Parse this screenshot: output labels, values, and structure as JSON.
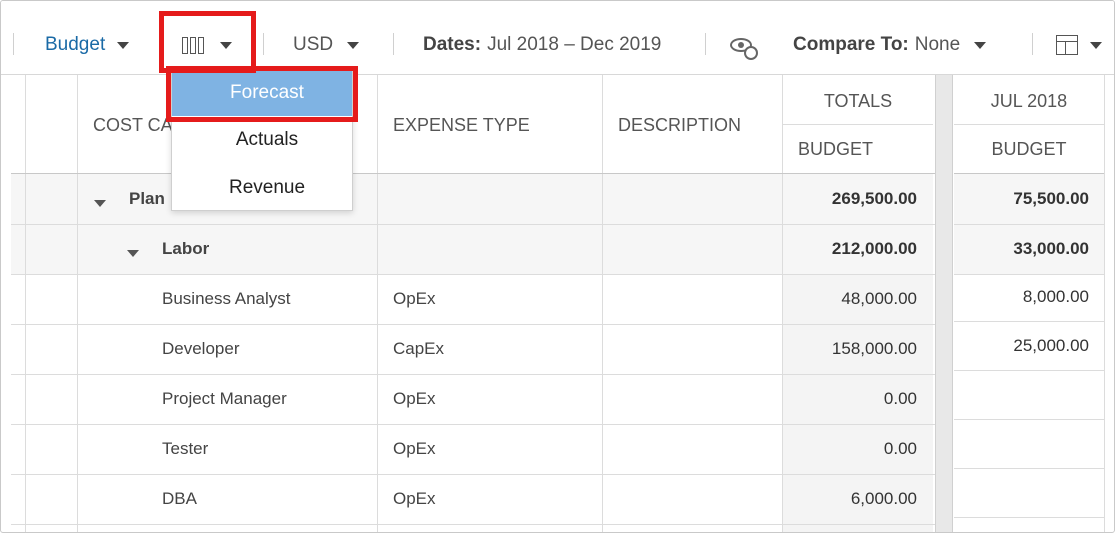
{
  "toolbar": {
    "scenario_label": "Budget",
    "currency_label": "USD",
    "dates_label": "Dates:",
    "dates_value": "Jul 2018 – Dec 2019",
    "compare_label": "Compare To:",
    "compare_value": "None"
  },
  "dropdown": {
    "items": [
      "Forecast",
      "Actuals",
      "Revenue"
    ],
    "selected": "Forecast"
  },
  "columns": {
    "cost_category": "COST CA",
    "expense_type": "EXPENSE TYPE",
    "description": "DESCRIPTION",
    "totals": "TOTALS",
    "totals_sub": "BUDGET",
    "month": "JUL 2018",
    "month_sub": "BUDGET"
  },
  "rows": [
    {
      "name": "Plan",
      "type": "",
      "total": "269,500.00",
      "month": "75,500.00"
    },
    {
      "name": "Labor",
      "type": "",
      "total": "212,000.00",
      "month": "33,000.00"
    },
    {
      "name": "Business Analyst",
      "type": "OpEx",
      "total": "48,000.00",
      "month": "8,000.00"
    },
    {
      "name": "Developer",
      "type": "CapEx",
      "total": "158,000.00",
      "month": "25,000.00"
    },
    {
      "name": "Project Manager",
      "type": "OpEx",
      "total": "0.00",
      "month": ""
    },
    {
      "name": "Tester",
      "type": "OpEx",
      "total": "0.00",
      "month": ""
    },
    {
      "name": "DBA",
      "type": "OpEx",
      "total": "6,000.00",
      "month": ""
    }
  ],
  "colors": {
    "highlight": "#e51b1b",
    "selected_item": "#7fb3e3",
    "link_blue": "#1a6aa6"
  },
  "icons": [
    "columns-icon",
    "hide-icon",
    "layout-grid-icon",
    "caret-down-icon"
  ]
}
